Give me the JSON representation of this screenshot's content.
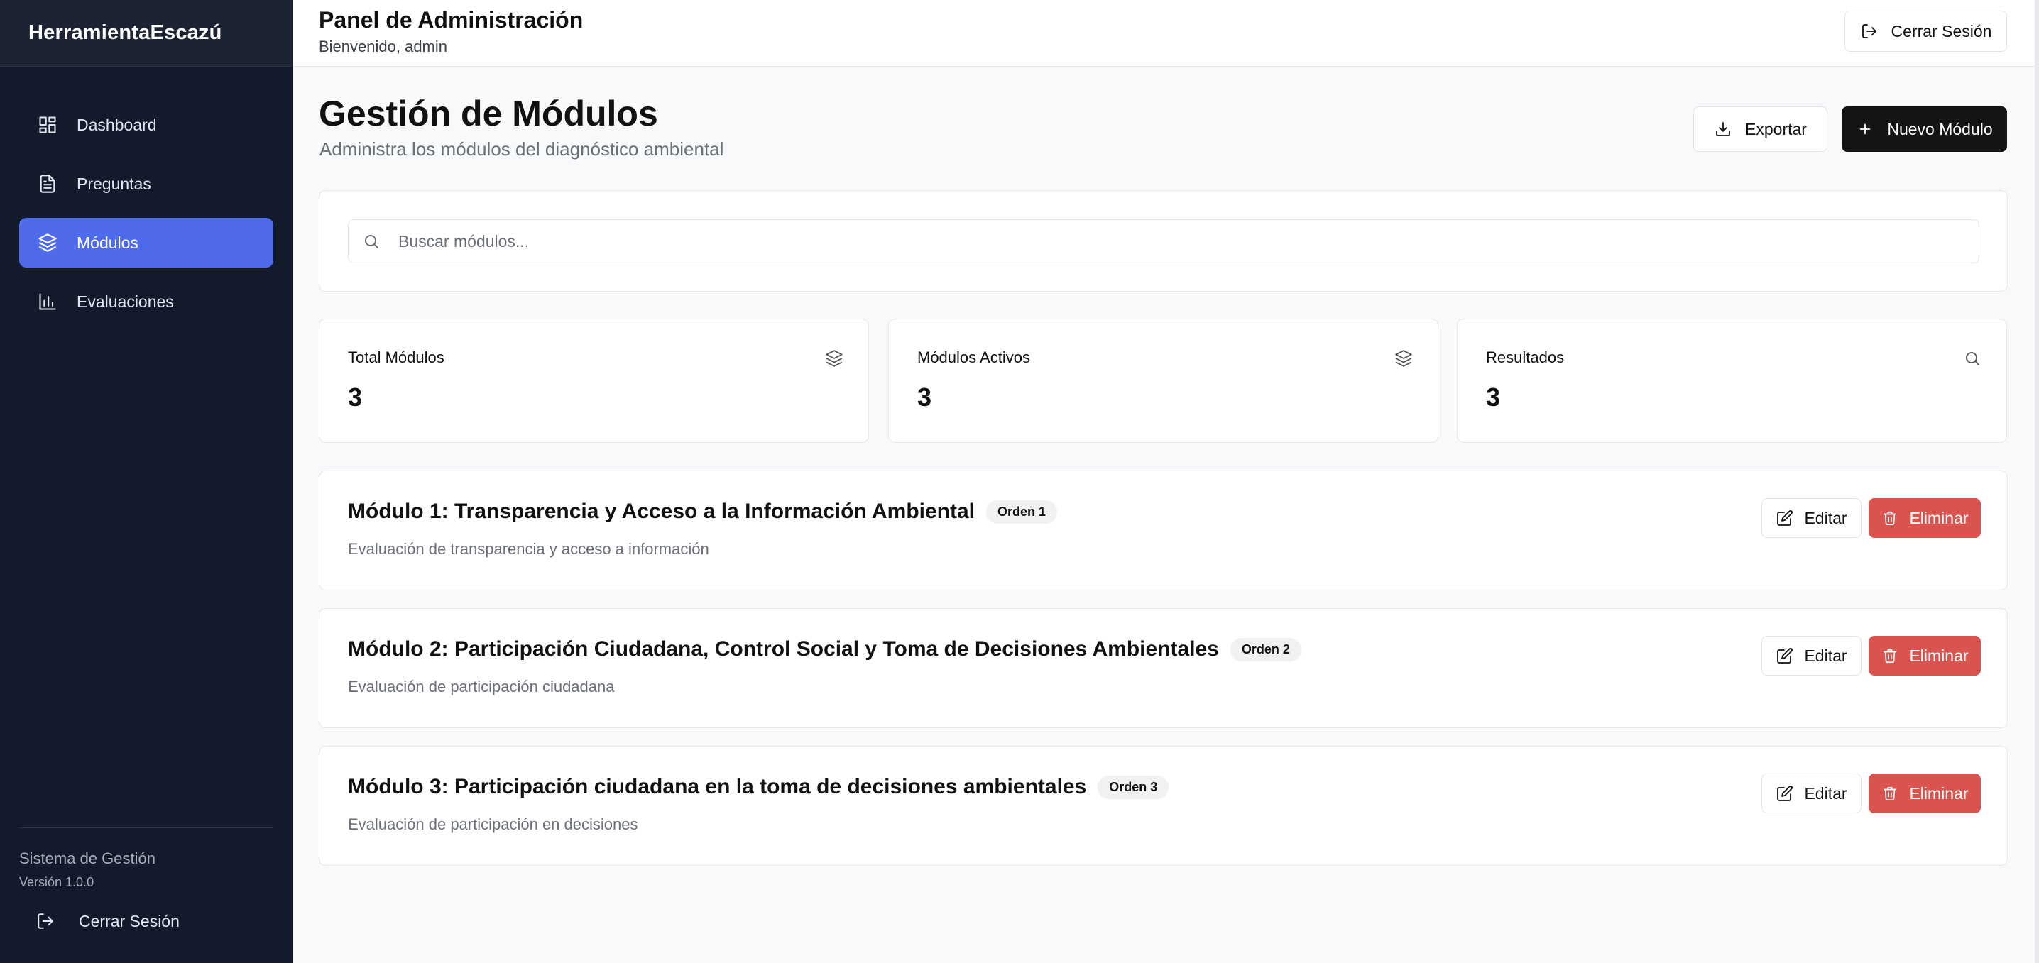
{
  "app": {
    "brand": "HerramientaEscazú"
  },
  "sidebar": {
    "items": [
      {
        "label": "Dashboard",
        "icon": "dashboard-icon",
        "active": false
      },
      {
        "label": "Preguntas",
        "icon": "document-icon",
        "active": false
      },
      {
        "label": "Módulos",
        "icon": "layers-icon",
        "active": true
      },
      {
        "label": "Evaluaciones",
        "icon": "bar-chart-icon",
        "active": false
      }
    ],
    "footer": {
      "system": "Sistema de Gestión",
      "version": "Versión 1.0.0",
      "logout": "Cerrar Sesión"
    }
  },
  "header": {
    "title": "Panel de Administración",
    "subtitle": "Bienvenido, admin",
    "logout": "Cerrar Sesión"
  },
  "main": {
    "title": "Gestión de Módulos",
    "subtitle": "Administra los módulos del diagnóstico ambiental",
    "export_label": "Exportar",
    "new_label": "Nuevo Módulo",
    "search": {
      "placeholder": "Buscar módulos...",
      "value": ""
    },
    "stats": [
      {
        "label": "Total Módulos",
        "value": "3",
        "icon": "layers-icon"
      },
      {
        "label": "Módulos Activos",
        "value": "3",
        "icon": "layers-icon"
      },
      {
        "label": "Resultados",
        "value": "3",
        "icon": "search-icon"
      }
    ],
    "modules": [
      {
        "title": "Módulo 1: Transparencia y Acceso a la Información Ambiental",
        "badge": "Orden 1",
        "description": "Evaluación de transparencia y acceso a información"
      },
      {
        "title": "Módulo 2: Participación Ciudadana, Control Social y Toma de Decisiones Ambientales",
        "badge": "Orden 2",
        "description": "Evaluación de participación ciudadana"
      },
      {
        "title": "Módulo 3: Participación ciudadana en la toma de decisiones ambientales",
        "badge": "Orden 3",
        "description": "Evaluación de participación en decisiones"
      }
    ],
    "edit_label": "Editar",
    "delete_label": "Eliminar"
  },
  "colors": {
    "sidebar_bg": "#121a2c",
    "active": "#4f6bec",
    "danger": "#d9534f",
    "primary_dark": "#141414"
  }
}
